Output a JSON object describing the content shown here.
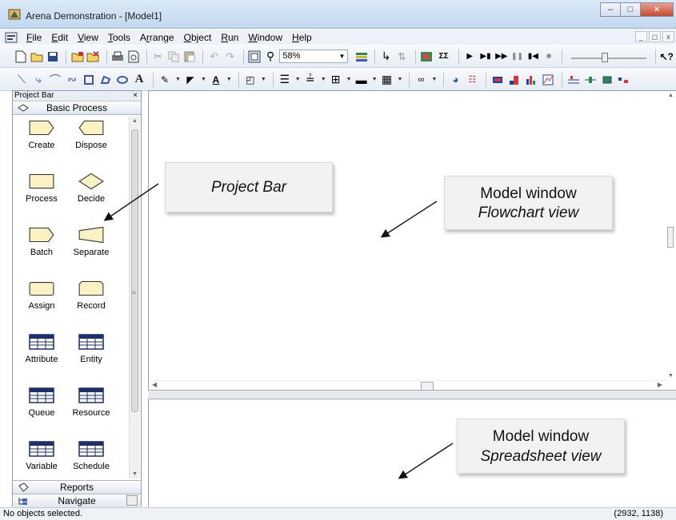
{
  "window": {
    "title": "Arena Demonstration - [Model1]"
  },
  "menu": {
    "items": [
      {
        "pre": "",
        "u": "F",
        "post": "ile"
      },
      {
        "pre": "",
        "u": "E",
        "post": "dit"
      },
      {
        "pre": "",
        "u": "V",
        "post": "iew"
      },
      {
        "pre": "",
        "u": "T",
        "post": "ools"
      },
      {
        "pre": "A",
        "u": "r",
        "post": "range"
      },
      {
        "pre": "",
        "u": "O",
        "post": "bject"
      },
      {
        "pre": "",
        "u": "R",
        "post": "un"
      },
      {
        "pre": "",
        "u": "W",
        "post": "indow"
      },
      {
        "pre": "",
        "u": "H",
        "post": "elp"
      }
    ]
  },
  "toolbar": {
    "zoom_value": "58%"
  },
  "project_bar": {
    "title": "Project Bar",
    "close": "×",
    "panel_title": "Basic Process",
    "modules": [
      {
        "label": "Create",
        "shape": "create"
      },
      {
        "label": "Dispose",
        "shape": "dispose"
      },
      {
        "label": "Process",
        "shape": "process"
      },
      {
        "label": "Decide",
        "shape": "decide"
      },
      {
        "label": "Batch",
        "shape": "batch"
      },
      {
        "label": "Separate",
        "shape": "separate"
      },
      {
        "label": "Assign",
        "shape": "assign"
      },
      {
        "label": "Record",
        "shape": "record"
      },
      {
        "label": "Attribute",
        "shape": "table"
      },
      {
        "label": "Entity",
        "shape": "table"
      },
      {
        "label": "Queue",
        "shape": "table"
      },
      {
        "label": "Resource",
        "shape": "table"
      },
      {
        "label": "Variable",
        "shape": "table"
      },
      {
        "label": "Schedule",
        "shape": "table"
      }
    ],
    "reports_label": "Reports",
    "navigate_label": "Navigate"
  },
  "annotations": {
    "project_bar": "Project Bar",
    "flowchart_line1": "Model window",
    "flowchart_line2": "Flowchart view",
    "spreadsheet_line1": "Model window",
    "spreadsheet_line2": "Spreadsheet view"
  },
  "status": {
    "selection": "No objects selected.",
    "coordinates": "(2932, 1138)"
  },
  "colors": {
    "module_fill": "#fbf2c4",
    "module_stroke": "#333333",
    "title_bar": "#c3d8ef"
  }
}
